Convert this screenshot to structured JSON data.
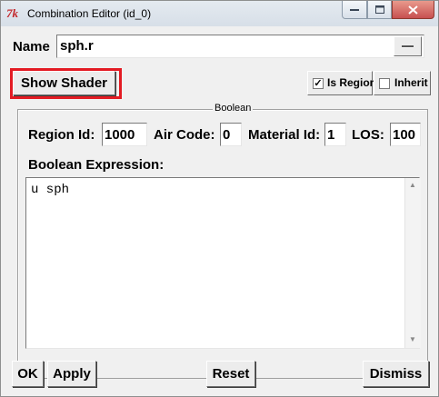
{
  "window": {
    "title": "Combination Editor (id_0)",
    "icon": "tk-feather-icon"
  },
  "name_row": {
    "label": "Name",
    "value": "sph.r"
  },
  "show_shader_button": "Show Shader",
  "is_region": {
    "label": "Is Region",
    "checked": true
  },
  "inherit": {
    "label": "Inherit",
    "checked": false
  },
  "boolean_group": {
    "legend": "Boolean",
    "region_id": {
      "label": "Region Id:",
      "value": "1000"
    },
    "air_code": {
      "label": "Air Code:",
      "value": "0"
    },
    "material_id": {
      "label": "Material Id:",
      "value": "1"
    },
    "los": {
      "label": "LOS:",
      "value": "100"
    },
    "expression_label": "Boolean Expression:",
    "expression_text": "u sph"
  },
  "footer": {
    "ok": "OK",
    "apply": "Apply",
    "reset": "Reset",
    "dismiss": "Dismiss"
  },
  "colors": {
    "highlight": "#e31b23",
    "close_button": "#c75050"
  }
}
